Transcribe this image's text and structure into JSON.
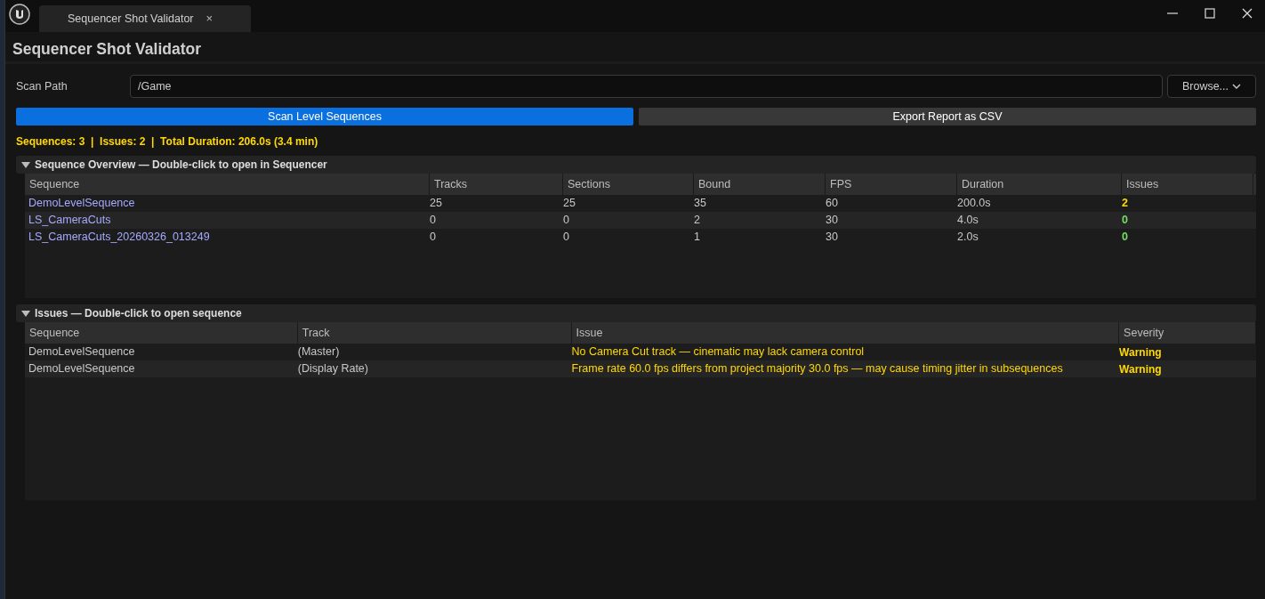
{
  "window": {
    "tab_title": "Sequencer Shot Validator",
    "close_tab": "×"
  },
  "header": {
    "title": "Sequencer Shot Validator"
  },
  "scan_path": {
    "label": "Scan Path",
    "value": "/Game",
    "browse": "Browse..."
  },
  "buttons": [
    {
      "label": "Scan Level Sequences",
      "kind": "primary"
    },
    {
      "label": "Export Report as CSV",
      "kind": "secondary"
    }
  ],
  "summary": "Sequences: 3  |  Issues: 2  |  Total Duration: 206.0s (3.4 min)",
  "overview": {
    "title": "Sequence Overview — Double-click to open in Sequencer",
    "expanded": true,
    "columns": [
      "Sequence",
      "Tracks",
      "Sections",
      "Bound",
      "FPS",
      "Duration",
      "Issues"
    ],
    "rows": [
      {
        "sequence": "DemoLevelSequence",
        "tracks": "25",
        "sections": "25",
        "bound": "35",
        "fps": "60",
        "duration": "200.0s",
        "issues": "2",
        "color": "#ffd800"
      },
      {
        "sequence": "LS_CameraCuts",
        "tracks": "0",
        "sections": "0",
        "bound": "2",
        "fps": "30",
        "duration": "4.0s",
        "issues": "0",
        "color": "#77dd66"
      },
      {
        "sequence": "LS_CameraCuts_20260326_013249",
        "tracks": "0",
        "sections": "0",
        "bound": "1",
        "fps": "30",
        "duration": "2.0s",
        "issues": "0",
        "color": "#77dd66"
      }
    ]
  },
  "issues": {
    "title": "Issues — Double-click to open sequence",
    "expanded": true,
    "columns": [
      "Sequence",
      "Track",
      "Issue",
      "Severity"
    ],
    "rows": [
      {
        "sequence": "DemoLevelSequence",
        "track": "(Master)",
        "issue": "No Camera Cut track — cinematic may lack camera control",
        "severity": "Warning"
      },
      {
        "sequence": "DemoLevelSequence",
        "track": "(Display Rate)",
        "issue": "Frame rate 60.0 fps differs from project majority 30.0 fps — may cause timing jitter in subsequences",
        "severity": "Warning"
      }
    ]
  }
}
